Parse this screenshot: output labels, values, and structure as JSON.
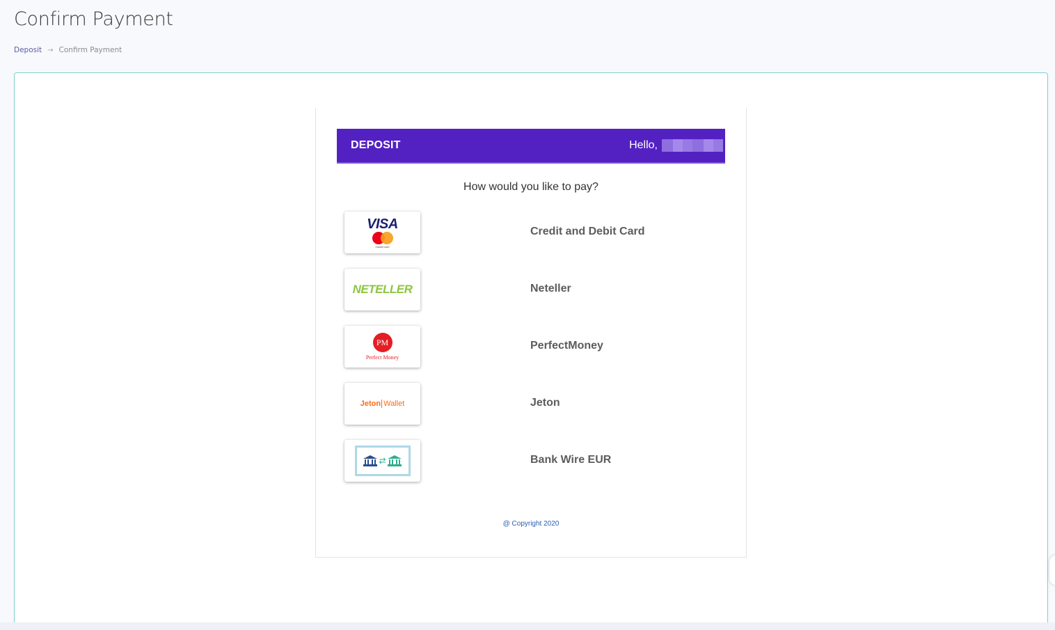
{
  "page": {
    "title": "Confirm Payment"
  },
  "breadcrumb": {
    "parent": "Deposit",
    "separator": "→",
    "current": "Confirm Payment"
  },
  "deposit_form": {
    "header_label": "DEPOSIT",
    "greeting": "Hello,",
    "question": "How would you like to pay?",
    "methods": [
      {
        "label": "Credit and Debit Card",
        "logo_text": "VISA",
        "logo_caption": "mastercard",
        "icon": "visa-mastercard-logo"
      },
      {
        "label": "Neteller",
        "logo_text": "NETELLER",
        "icon": "neteller-logo"
      },
      {
        "label": "PerfectMoney",
        "logo_text": "PM",
        "logo_caption": "Perfect Money",
        "icon": "perfectmoney-logo"
      },
      {
        "label": "Jeton",
        "logo_text": "Jeton",
        "logo_caption": "Wallet",
        "icon": "jeton-wallet-logo"
      },
      {
        "label": "Bank Wire EUR",
        "icon": "bank-transfer-logo"
      }
    ],
    "copyright": "@ Copyright 2020"
  },
  "colors": {
    "header_bg": "#5321c1",
    "card_border": "#7fd0cf",
    "breadcrumb_link": "#5d5d9e",
    "copyright": "#2a5db0"
  }
}
